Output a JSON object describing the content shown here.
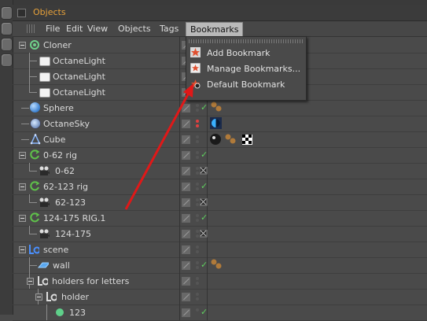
{
  "window": {
    "title": "Objects"
  },
  "menu": {
    "items": [
      "File",
      "Edit",
      "View",
      "Objects",
      "Tags",
      "Bookmarks"
    ]
  },
  "bookmarks_menu": {
    "items": [
      "Add Bookmark",
      "Manage Bookmarks...",
      "Default Bookmark"
    ]
  },
  "tree": {
    "rows": [
      {
        "label": "Cloner"
      },
      {
        "label": "OctaneLight"
      },
      {
        "label": "OctaneLight"
      },
      {
        "label": "OctaneLight"
      },
      {
        "label": "Sphere"
      },
      {
        "label": "OctaneSky"
      },
      {
        "label": "Cube"
      },
      {
        "label": "0-62 rig"
      },
      {
        "label": "0-62"
      },
      {
        "label": "62-123 rig"
      },
      {
        "label": "62-123"
      },
      {
        "label": "124-175 RIG.1"
      },
      {
        "label": "124-175"
      },
      {
        "label": "scene"
      },
      {
        "label": "wall"
      },
      {
        "label": "holders for letters"
      },
      {
        "label": "holder"
      },
      {
        "label": "123"
      }
    ]
  },
  "colors": {
    "title": "#e8a23a",
    "arrow": "#e01818",
    "check": "#5fd05f"
  }
}
